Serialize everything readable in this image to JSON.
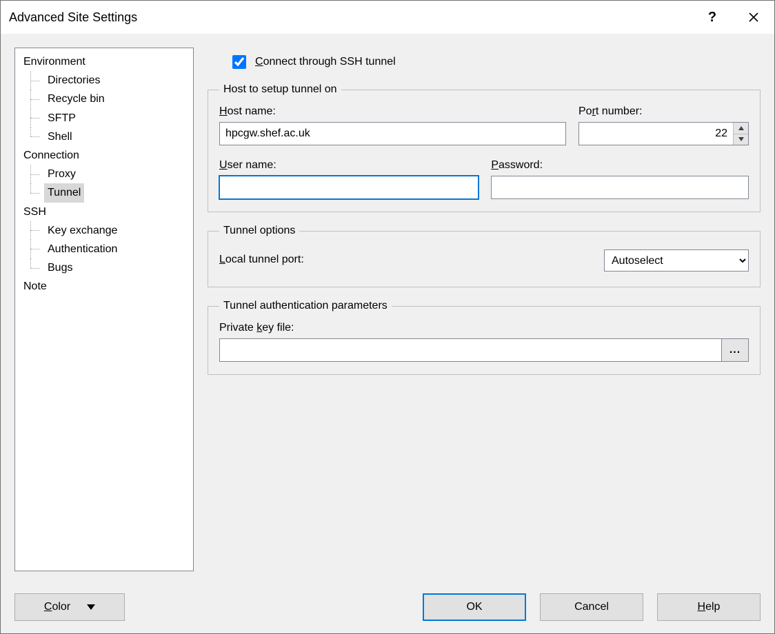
{
  "window": {
    "title": "Advanced Site Settings"
  },
  "tree": {
    "environment": {
      "label": "Environment",
      "directories": "Directories",
      "recycle_bin": "Recycle bin",
      "sftp": "SFTP",
      "shell": "Shell"
    },
    "connection": {
      "label": "Connection",
      "proxy": "Proxy",
      "tunnel": "Tunnel"
    },
    "ssh": {
      "label": "SSH",
      "key_exchange": "Key exchange",
      "authentication": "Authentication",
      "bugs": "Bugs"
    },
    "note": {
      "label": "Note"
    }
  },
  "connect_checkbox": {
    "checked": true,
    "label_pre": "C",
    "label_post": "onnect through SSH tunnel"
  },
  "group_host": {
    "legend": "Host to setup tunnel on",
    "hostname_label_pre": "H",
    "hostname_label_post": "ost name:",
    "hostname_value": "hpcgw.shef.ac.uk",
    "port_label_pre": "Po",
    "port_label_u": "r",
    "port_label_post": "t number:",
    "port_value": "22",
    "username_label_pre": "U",
    "username_label_post": "ser name:",
    "username_value": "",
    "password_label_pre": "P",
    "password_label_post": "assword:",
    "password_value": ""
  },
  "group_opts": {
    "legend": "Tunnel options",
    "local_port_label_pre": "L",
    "local_port_label_post": "ocal tunnel port:",
    "local_port_value": "Autoselect"
  },
  "group_auth": {
    "legend": "Tunnel authentication parameters",
    "keyfile_label_pre": "Private ",
    "keyfile_label_u": "k",
    "keyfile_label_post": "ey file:",
    "keyfile_value": "",
    "browse_label": "..."
  },
  "buttons": {
    "color_pre": "C",
    "color_post": "olor",
    "ok": "OK",
    "cancel": "Cancel",
    "help_pre": "H",
    "help_post": "elp"
  }
}
